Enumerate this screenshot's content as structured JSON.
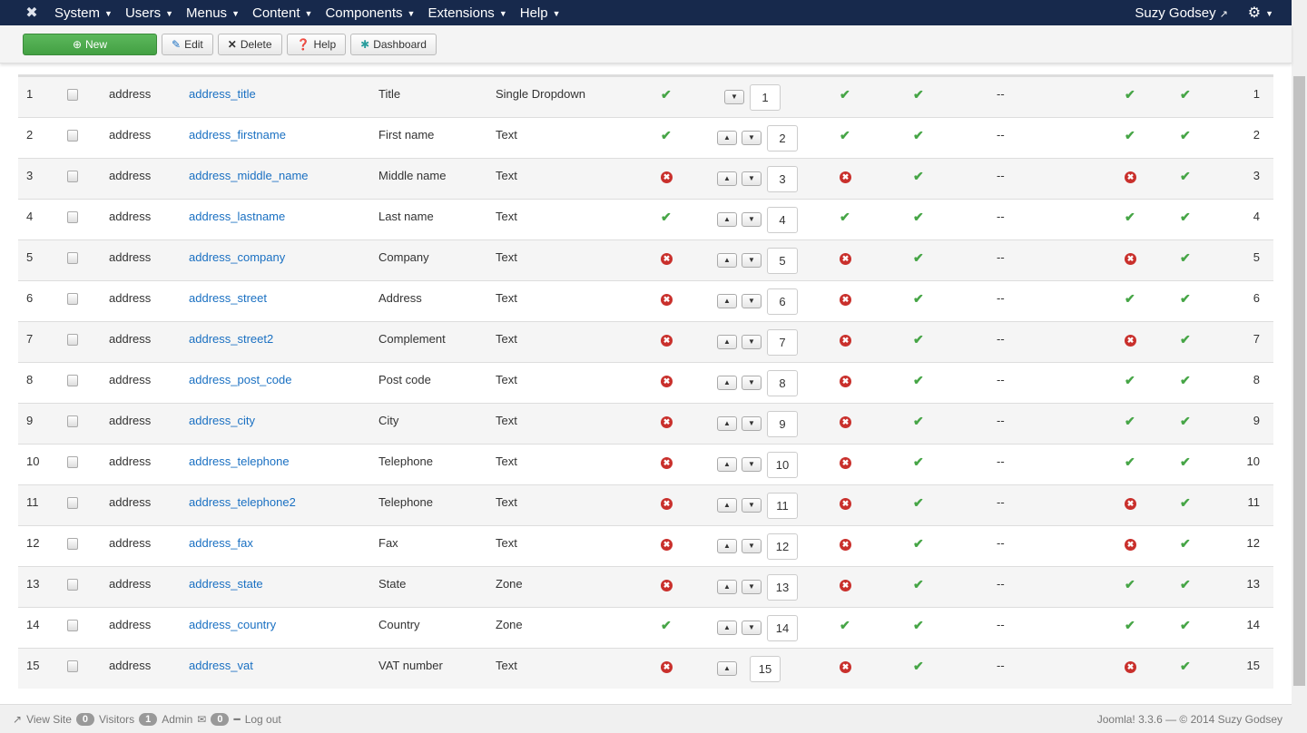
{
  "nav": {
    "menus": [
      "System",
      "Users",
      "Menus",
      "Content",
      "Components",
      "Extensions",
      "Help"
    ],
    "user": "Suzy Godsey"
  },
  "toolbar": {
    "new": "New",
    "edit": "Edit",
    "delete": "Delete",
    "help": "Help",
    "dashboard": "Dashboard"
  },
  "rows": [
    {
      "id": "1",
      "table": "address",
      "name": "address_title",
      "label": "Title",
      "type": "Single Dropdown",
      "pub": true,
      "a": true,
      "b": true,
      "dash": "--",
      "c": true,
      "d": true,
      "order": "1",
      "up": false,
      "down": true
    },
    {
      "id": "2",
      "table": "address",
      "name": "address_firstname",
      "label": "First name",
      "type": "Text",
      "pub": true,
      "a": true,
      "b": true,
      "dash": "--",
      "c": true,
      "d": true,
      "order": "2",
      "up": true,
      "down": true
    },
    {
      "id": "3",
      "table": "address",
      "name": "address_middle_name",
      "label": "Middle name",
      "type": "Text",
      "pub": false,
      "a": false,
      "b": true,
      "dash": "--",
      "c": false,
      "d": true,
      "order": "3",
      "up": true,
      "down": true
    },
    {
      "id": "4",
      "table": "address",
      "name": "address_lastname",
      "label": "Last name",
      "type": "Text",
      "pub": true,
      "a": true,
      "b": true,
      "dash": "--",
      "c": true,
      "d": true,
      "order": "4",
      "up": true,
      "down": true
    },
    {
      "id": "5",
      "table": "address",
      "name": "address_company",
      "label": "Company",
      "type": "Text",
      "pub": false,
      "a": false,
      "b": true,
      "dash": "--",
      "c": false,
      "d": true,
      "order": "5",
      "up": true,
      "down": true
    },
    {
      "id": "6",
      "table": "address",
      "name": "address_street",
      "label": "Address",
      "type": "Text",
      "pub": false,
      "a": false,
      "b": true,
      "dash": "--",
      "c": true,
      "d": true,
      "order": "6",
      "up": true,
      "down": true
    },
    {
      "id": "7",
      "table": "address",
      "name": "address_street2",
      "label": "Complement",
      "type": "Text",
      "pub": false,
      "a": false,
      "b": true,
      "dash": "--",
      "c": false,
      "d": true,
      "order": "7",
      "up": true,
      "down": true
    },
    {
      "id": "8",
      "table": "address",
      "name": "address_post_code",
      "label": "Post code",
      "type": "Text",
      "pub": false,
      "a": false,
      "b": true,
      "dash": "--",
      "c": true,
      "d": true,
      "order": "8",
      "up": true,
      "down": true
    },
    {
      "id": "9",
      "table": "address",
      "name": "address_city",
      "label": "City",
      "type": "Text",
      "pub": false,
      "a": false,
      "b": true,
      "dash": "--",
      "c": true,
      "d": true,
      "order": "9",
      "up": true,
      "down": true
    },
    {
      "id": "10",
      "table": "address",
      "name": "address_telephone",
      "label": "Telephone",
      "type": "Text",
      "pub": false,
      "a": false,
      "b": true,
      "dash": "--",
      "c": true,
      "d": true,
      "order": "10",
      "up": true,
      "down": true
    },
    {
      "id": "11",
      "table": "address",
      "name": "address_telephone2",
      "label": "Telephone",
      "type": "Text",
      "pub": false,
      "a": false,
      "b": true,
      "dash": "--",
      "c": false,
      "d": true,
      "order": "11",
      "up": true,
      "down": true
    },
    {
      "id": "12",
      "table": "address",
      "name": "address_fax",
      "label": "Fax",
      "type": "Text",
      "pub": false,
      "a": false,
      "b": true,
      "dash": "--",
      "c": false,
      "d": true,
      "order": "12",
      "up": true,
      "down": true
    },
    {
      "id": "13",
      "table": "address",
      "name": "address_state",
      "label": "State",
      "type": "Zone",
      "pub": false,
      "a": false,
      "b": true,
      "dash": "--",
      "c": true,
      "d": true,
      "order": "13",
      "up": true,
      "down": true
    },
    {
      "id": "14",
      "table": "address",
      "name": "address_country",
      "label": "Country",
      "type": "Zone",
      "pub": true,
      "a": true,
      "b": true,
      "dash": "--",
      "c": true,
      "d": true,
      "order": "14",
      "up": true,
      "down": true
    },
    {
      "id": "15",
      "table": "address",
      "name": "address_vat",
      "label": "VAT number",
      "type": "Text",
      "pub": false,
      "a": false,
      "b": true,
      "dash": "--",
      "c": false,
      "d": true,
      "order": "15",
      "up": true,
      "down": false
    }
  ],
  "footer": {
    "view_site": "View Site",
    "visitors_count": "0",
    "visitors": "Visitors",
    "admin_count": "1",
    "admin": "Admin",
    "messages_count": "0",
    "logout": "Log out",
    "copyright": "Joomla! 3.3.6  —  © 2014 Suzy Godsey"
  }
}
